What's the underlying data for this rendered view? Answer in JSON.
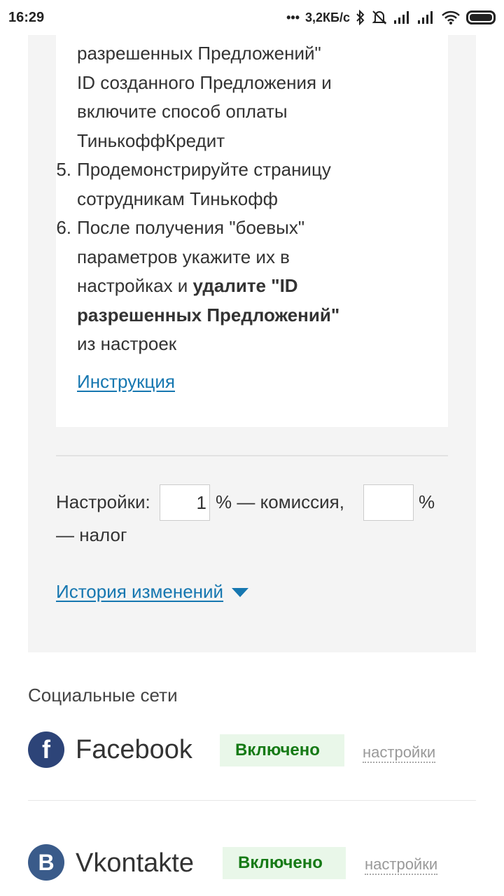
{
  "status_bar": {
    "time": "16:29",
    "network_speed": "3,2КБ/с",
    "icons": [
      "more-dots-icon",
      "bluetooth-icon",
      "mute-bell-icon",
      "signal-icon",
      "signal-icon",
      "wifi-icon",
      "battery-icon"
    ]
  },
  "instructions": {
    "step4_continued": [
      "разрешенных Предложений\"",
      "ID созданного Предложения и",
      "включите способ оплаты",
      "ТинькоффКредит"
    ],
    "step5": {
      "number": "5.",
      "lines": [
        "Продемонстрируйте страницу",
        "сотрудникам Тинькофф"
      ]
    },
    "step6": {
      "number": "6.",
      "line1": "После получения \"боевых\"",
      "line2": "параметров укажите их в",
      "line3_normal": "настройках и ",
      "line3_bold": "удалите \"ID",
      "line4_bold": "разрешенных Предложений\"",
      "line5": "из настроек"
    },
    "instruction_link": "Инструкция"
  },
  "settings": {
    "label": "Настройки:",
    "commission_value": "1",
    "commission_suffix": "% — комиссия,",
    "tax_value": "",
    "tax_suffix_pct": "%",
    "tax_suffix_text": "— налог",
    "history_link": "История изменений"
  },
  "social": {
    "title": "Социальные сети",
    "items": [
      {
        "icon_letter": "f",
        "name": "Facebook",
        "status": "Включено",
        "settings_link": "настройки"
      },
      {
        "icon_letter": "B",
        "name": "Vkontakte",
        "status": "Включено",
        "settings_link": "настройки"
      }
    ]
  },
  "colors": {
    "link": "#1677b0",
    "status_ok_bg": "#e9f7e9",
    "status_ok_text": "#167a16",
    "panel_bg": "#f4f4f4"
  }
}
